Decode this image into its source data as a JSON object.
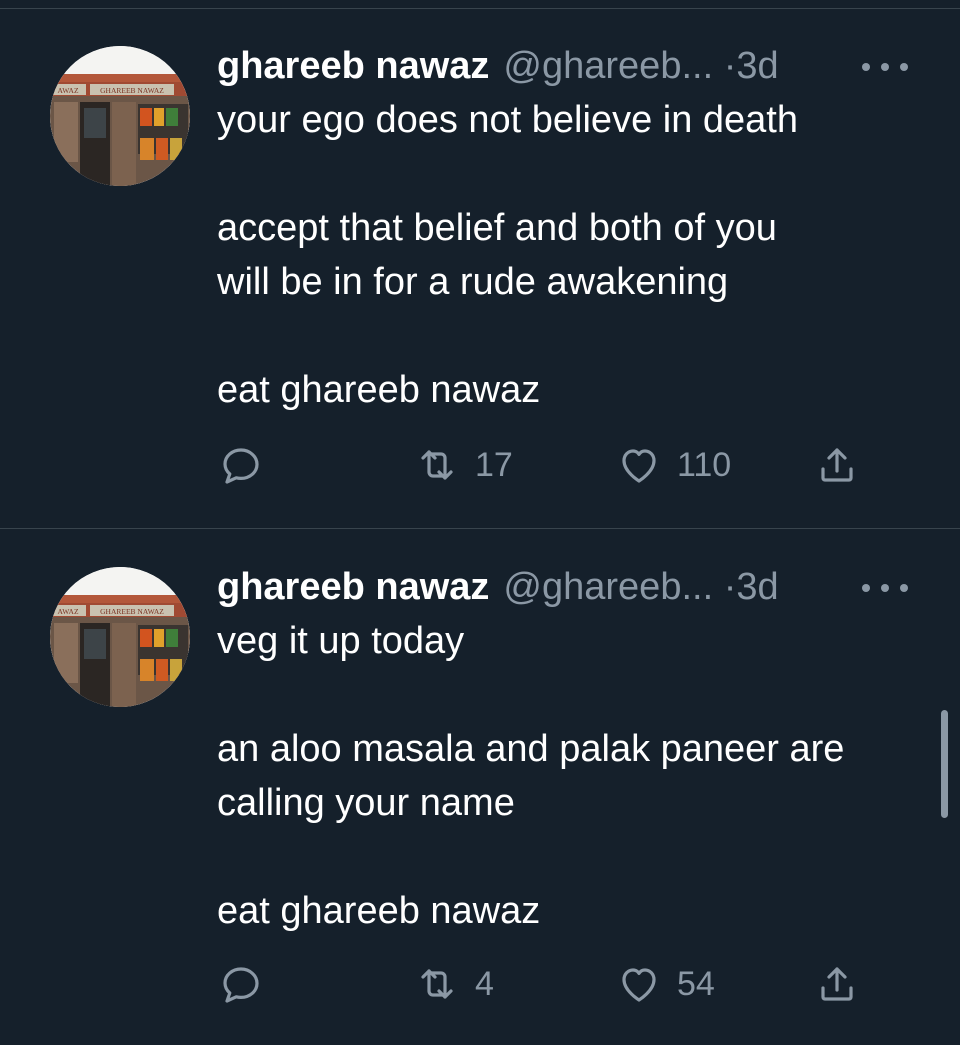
{
  "accent_colors": {
    "background": "#15202b",
    "text_primary": "#ffffff",
    "text_secondary": "#8b98a5",
    "divider": "#38444d"
  },
  "tweets": [
    {
      "name": "ghareeb nawaz",
      "handle": "@ghareeb...",
      "separator": "·",
      "time": "3d",
      "avatar_sign": "GHAREEB NAWAZ",
      "avatar_sign_left": "AWAZ",
      "paragraphs": [
        [
          "your ego does not believe in death"
        ],
        [
          "accept that belief and both of you",
          "will be in for a rude awakening"
        ],
        [
          "eat ghareeb nawaz"
        ]
      ],
      "retweets": "17",
      "likes": "110"
    },
    {
      "name": "ghareeb nawaz",
      "handle": "@ghareeb...",
      "separator": "·",
      "time": "3d",
      "avatar_sign": "GHAREEB NAWAZ",
      "avatar_sign_left": "AWAZ",
      "paragraphs": [
        [
          "veg it up today"
        ],
        [
          "an aloo masala and palak paneer are",
          "calling your name"
        ],
        [
          "eat ghareeb nawaz"
        ]
      ],
      "retweets": "4",
      "likes": "54"
    }
  ],
  "icons": {
    "reply": "reply-icon",
    "retweet": "retweet-icon",
    "like": "heart-icon",
    "share": "share-icon",
    "more": "more-horizontal-icon"
  }
}
